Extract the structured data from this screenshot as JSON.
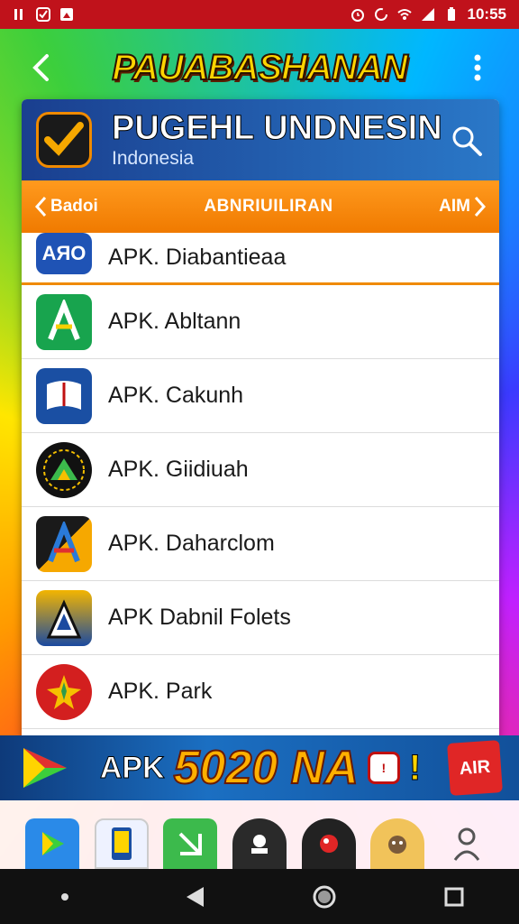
{
  "status_bar": {
    "time": "10:55",
    "left_icons": [
      "notification-icon",
      "check-icon",
      "gallery-icon"
    ],
    "right_icons": [
      "alarm-icon",
      "sync-icon",
      "wifi-icon",
      "signal-icon",
      "battery-icon"
    ]
  },
  "top_bar": {
    "title": "PAUABASHANAN"
  },
  "card_header": {
    "title": "PUGEHL UNDNESIN",
    "subtitle": "Indonesia"
  },
  "tab_bar": {
    "prev_label": "Badoi",
    "center_label": "ABNRIUILIRAN",
    "next_label": "AIM"
  },
  "apps": [
    {
      "name": "APK. Diabantieaa",
      "icon": "abo-app-icon",
      "color": "#1f53b5"
    },
    {
      "name": "APK. Abltann",
      "icon": "green-a-app-icon",
      "color": "#18a44e"
    },
    {
      "name": "APK. Cakunh",
      "icon": "book-app-icon",
      "color": "#1a4fa3"
    },
    {
      "name": "APK. Giidiuah",
      "icon": "dark-triangle-app-icon",
      "color": "#111111"
    },
    {
      "name": "APK. Daharclom",
      "icon": "color-a-app-icon",
      "color": "#1a1a1a"
    },
    {
      "name": "APK Dabnil Folets",
      "icon": "yellow-a-app-icon",
      "color": "#f3b500"
    },
    {
      "name": "APK. Park",
      "icon": "star-app-icon",
      "color": "#d31f1f"
    }
  ],
  "promo": {
    "apk_label": "APK",
    "big_text": "5020 NA",
    "excl": "!",
    "badge_text": "AIR"
  },
  "dock": [
    "play-store-icon",
    "phone-app-icon",
    "green-app-icon",
    "dark-circle-app-icon",
    "red-app-icon",
    "cat-app-icon",
    "person-app-icon"
  ],
  "colors": {
    "status_bar": "#c0121b",
    "accent_orange": "#f08a00",
    "header_blue": "#1a3f8f"
  }
}
